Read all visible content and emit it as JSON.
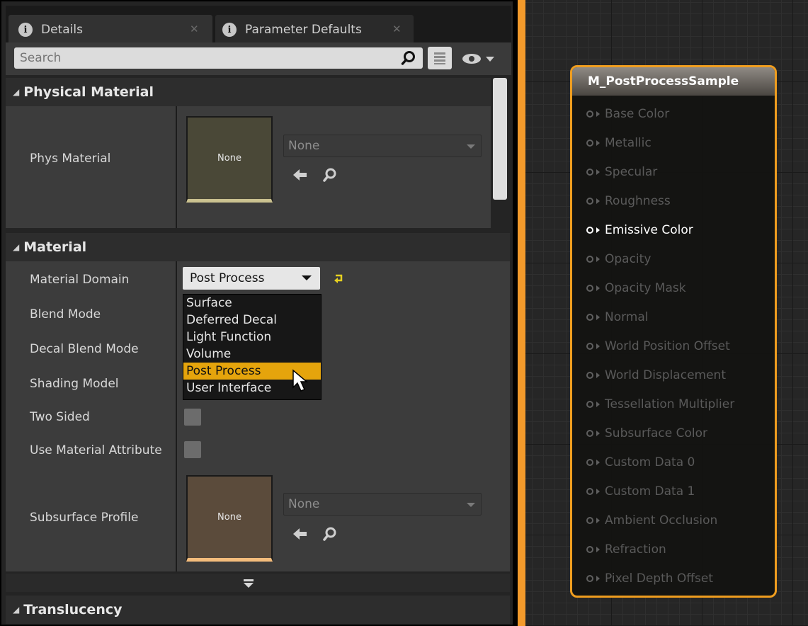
{
  "tabs": [
    {
      "label": "Details"
    },
    {
      "label": "Parameter Defaults"
    }
  ],
  "search": {
    "placeholder": "Search"
  },
  "sections": {
    "physical_material": {
      "title": "Physical Material",
      "phys_material_label": "Phys Material",
      "thumb_text": "None",
      "combo_value": "None"
    },
    "material": {
      "title": "Material",
      "labels": [
        "Material Domain",
        "Blend Mode",
        "Decal Blend Mode",
        "Shading Model",
        "Two Sided",
        "Use Material Attribute"
      ],
      "material_domain_value": "Post Process",
      "dropdown_options": [
        "Surface",
        "Deferred Decal",
        "Light Function",
        "Volume",
        "Post Process",
        "User Interface"
      ],
      "selected_option": "Post Process",
      "subsurface_label": "Subsurface Profile",
      "subsurface_thumb_text": "None",
      "subsurface_combo_value": "None"
    },
    "translucency": {
      "title": "Translucency"
    }
  },
  "node": {
    "title": "M_PostProcessSample",
    "pins": [
      "Base Color",
      "Metallic",
      "Specular",
      "Roughness",
      "Emissive Color",
      "Opacity",
      "Opacity Mask",
      "Normal",
      "World Position Offset",
      "World Displacement",
      "Tessellation Multiplier",
      "Subsurface Color",
      "Custom Data 0",
      "Custom Data 1",
      "Ambient Occlusion",
      "Refraction",
      "Pixel Depth Offset"
    ],
    "active_pin": "Emissive Color"
  },
  "colors": {
    "accent_orange": "#f39a2b",
    "selection_yellow": "#e5a40c",
    "node_border": "#ef9d1f"
  }
}
